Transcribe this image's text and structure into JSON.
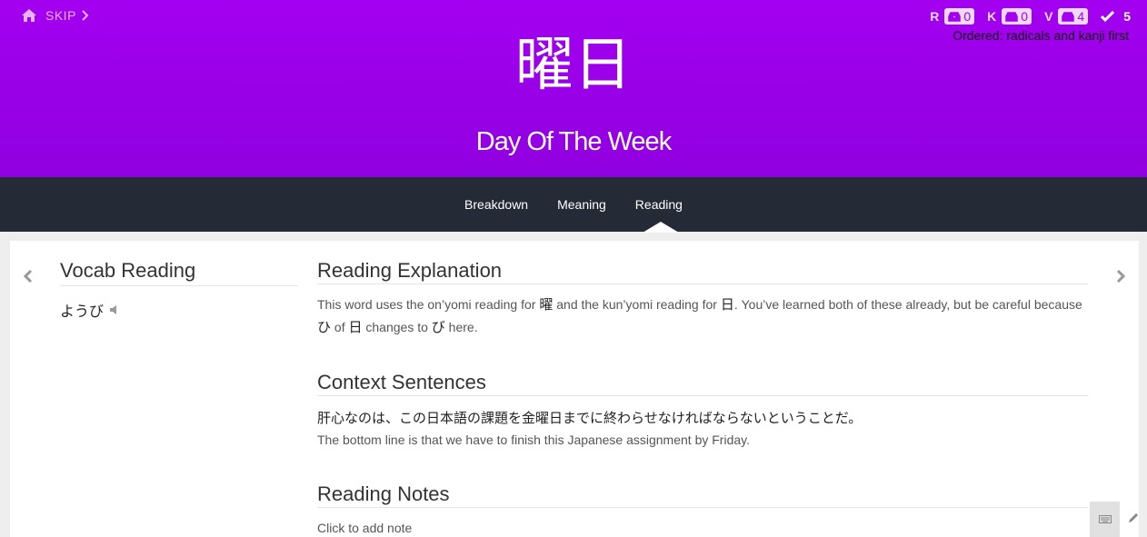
{
  "header": {
    "skip_label": "SKIP",
    "character": "曜日",
    "meaning": "Day Of The Week",
    "ordered_text": "Ordered: radicals and kanji first",
    "stats": [
      {
        "letter": "R",
        "count": "0"
      },
      {
        "letter": "K",
        "count": "0"
      },
      {
        "letter": "V",
        "count": "4"
      }
    ],
    "completed_count": "5"
  },
  "tabs": [
    {
      "label": "Breakdown"
    },
    {
      "label": "Meaning"
    },
    {
      "label": "Reading"
    }
  ],
  "active_tab": "Reading",
  "vocab_reading": {
    "title": "Vocab Reading",
    "reading": "ようび"
  },
  "reading_explanation": {
    "title": "Reading Explanation",
    "parts": [
      "This word uses the on’yomi reading for ",
      "曜",
      " and the kun’yomi reading for ",
      "日",
      ". You’ve learned both of these already, but be careful because ",
      "ひ",
      " of ",
      "日",
      " changes to ",
      "び",
      " here."
    ]
  },
  "context_sentences": {
    "title": "Context Sentences",
    "japanese": "肝心なのは、この日本語の課題を金曜日までに終わらせなければならないということだ。",
    "english": "The bottom line is that we have to finish this Japanese assignment by Friday."
  },
  "reading_notes": {
    "title": "Reading Notes",
    "placeholder": "Click to add note"
  },
  "colors": {
    "header_bg": "#a300f0",
    "nav_bg": "#242a36",
    "badge_bg": "#f0d9ff"
  },
  "icons": [
    "home-icon",
    "chevron-right-icon",
    "inbox-icon",
    "check-icon",
    "chevron-left-icon",
    "speaker-icon",
    "keyboard-icon",
    "pencil-icon"
  ]
}
